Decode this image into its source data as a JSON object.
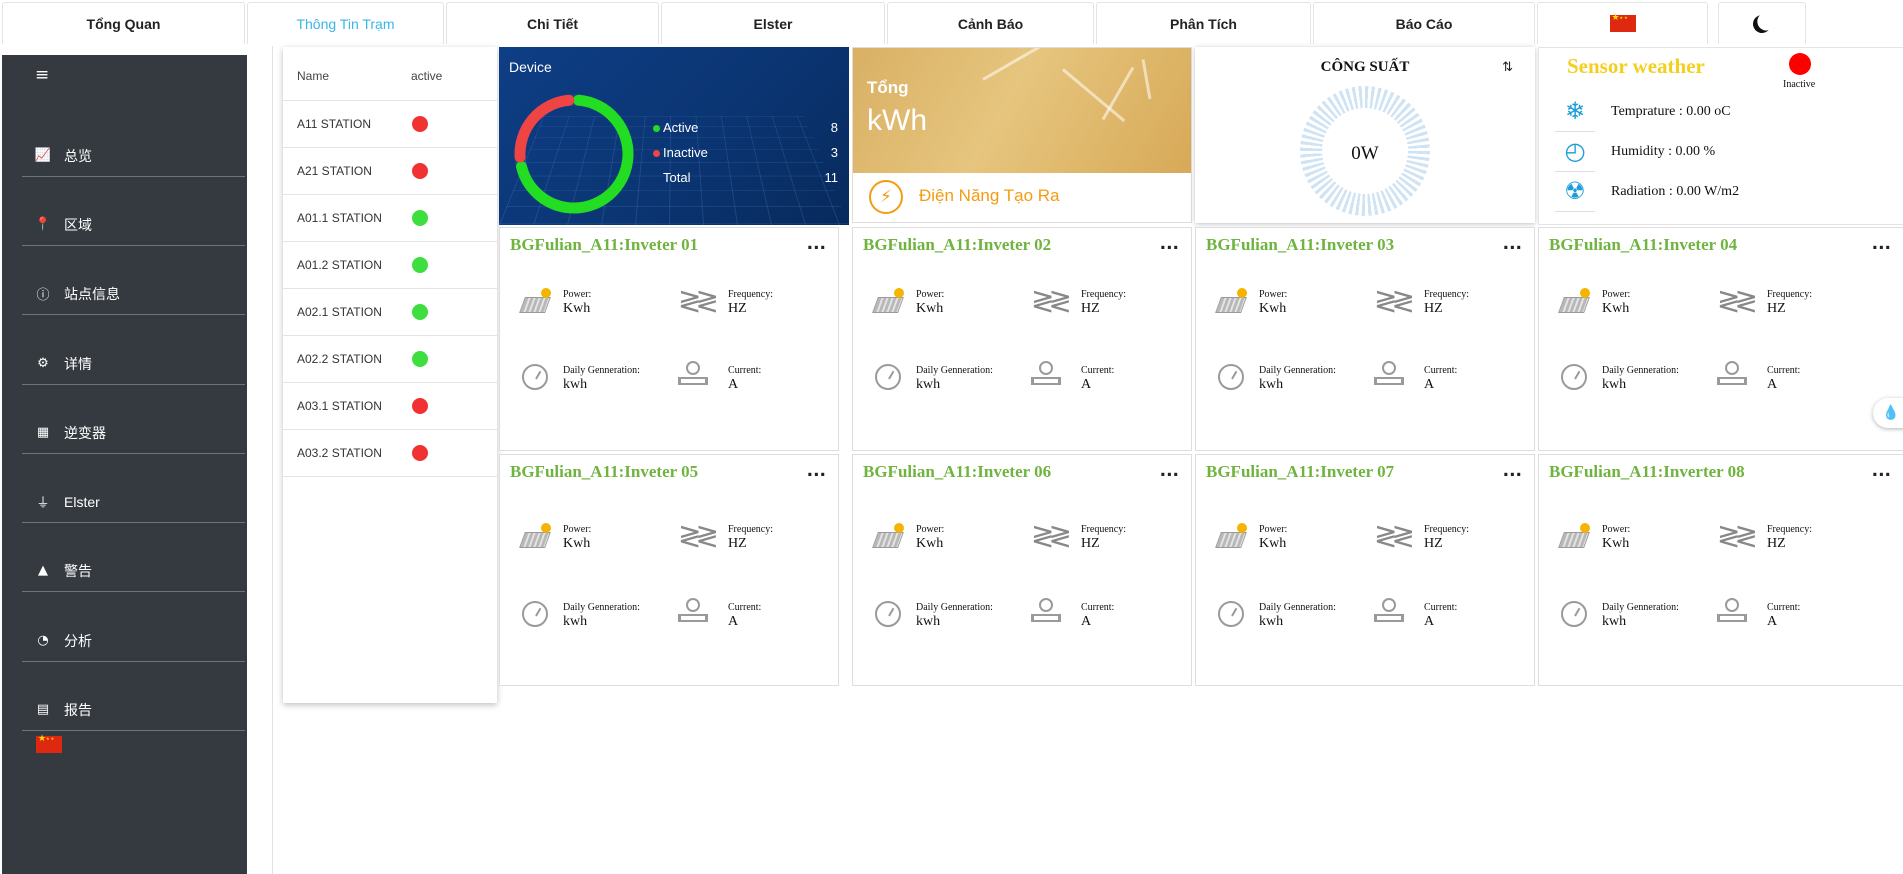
{
  "nav": {
    "tabs": [
      "Tổng Quan",
      "Thông Tin Trạm",
      "Chi Tiết",
      "Elster",
      "Cảnh Báo",
      "Phân Tích",
      "Báo Cáo"
    ],
    "active_tab": "Thông Tin Trạm",
    "language_icon": "china-flag-icon",
    "theme_icon": "moon-icon"
  },
  "sidebar": {
    "menu_icon": "hamburger-menu-icon",
    "menu_glyph": "≡",
    "items": [
      {
        "label": "总览",
        "icon": "chart-line-icon",
        "glyph": "📈"
      },
      {
        "label": "区域",
        "icon": "map-marker-icon",
        "glyph": "📍"
      },
      {
        "label": "站点信息",
        "icon": "info-circle-icon",
        "glyph": "ⓘ"
      },
      {
        "label": "详情",
        "icon": "gears-icon",
        "glyph": "⚙"
      },
      {
        "label": "逆变器",
        "icon": "solar-panel-icon",
        "glyph": "▦"
      },
      {
        "label": "Elster",
        "icon": "plug-icon",
        "glyph": "⏚"
      },
      {
        "label": "警告",
        "icon": "warning-triangle-icon",
        "glyph": "▲"
      },
      {
        "label": "分析",
        "icon": "pie-chart-icon",
        "glyph": "◔"
      },
      {
        "label": "报告",
        "icon": "file-icon",
        "glyph": "▤"
      }
    ],
    "language_icon": "china-flag-icon"
  },
  "stations": {
    "col_name": "Name",
    "col_active": "active",
    "rows": [
      {
        "name": "A11 STATION",
        "status": "inactive",
        "color": "#f03232"
      },
      {
        "name": "A21 STATION",
        "status": "inactive",
        "color": "#f03232"
      },
      {
        "name": "A01.1 STATION",
        "status": "active",
        "color": "#3ede3e"
      },
      {
        "name": "A01.2 STATION",
        "status": "active",
        "color": "#3ede3e"
      },
      {
        "name": "A02.1 STATION",
        "status": "active",
        "color": "#3ede3e"
      },
      {
        "name": "A02.2 STATION",
        "status": "active",
        "color": "#3ede3e"
      },
      {
        "name": "A03.1 STATION",
        "status": "inactive",
        "color": "#f03232"
      },
      {
        "name": "A03.2 STATION",
        "status": "inactive",
        "color": "#f03232"
      }
    ]
  },
  "device": {
    "title": "Device",
    "active_label": "Active",
    "active_value": "8",
    "inactive_label": "Inactive",
    "inactive_value": "3",
    "total_label": "Total",
    "total_value": "11",
    "colors": {
      "active": "#22dd22",
      "inactive": "#ee4444"
    }
  },
  "energy": {
    "line1": "Tổng",
    "line2": "kWh",
    "icon": "lightning-bolt-icon",
    "icon_glyph": "⚡",
    "label": "Điện Năng Tạo Ra"
  },
  "power": {
    "title": "CÔNG SUẤT",
    "sort_icon": "sort-arrows-icon",
    "sort_glyph": "⇅",
    "value": "0W"
  },
  "weather": {
    "title": "Sensor weather",
    "status": "Inactive",
    "rows": [
      {
        "icon": "snowflake-icon",
        "glyph": "❄",
        "text": "Temprature : 0.00 oC"
      },
      {
        "icon": "humidity-gauge-icon",
        "glyph": "◴",
        "text": "Humidity : 0.00 %"
      },
      {
        "icon": "radiation-icon",
        "glyph": "☢",
        "text": "Radiation : 0.00 W/m2"
      }
    ]
  },
  "inverter_labels": {
    "more": "...",
    "power": "Power:",
    "power_unit": "Kwh",
    "frequency": "Frequency:",
    "frequency_unit": "HZ",
    "daily": "Daily Genneration:",
    "daily_unit": "kwh",
    "current": "Current:",
    "current_unit": "A"
  },
  "inverters": [
    "BGFulian_A11:Inveter 01",
    "BGFulian_A11:Inveter 02",
    "BGFulian_A11:Inveter 03",
    "BGFulian_A11:Inveter 04",
    "BGFulian_A11:Inveter 05",
    "BGFulian_A11:Inveter 06",
    "BGFulian_A11:Inveter 07",
    "BGFulian_A11:Inverter 08"
  ],
  "float_button": {
    "icon": "water-drops-icon",
    "glyph": "💧"
  }
}
